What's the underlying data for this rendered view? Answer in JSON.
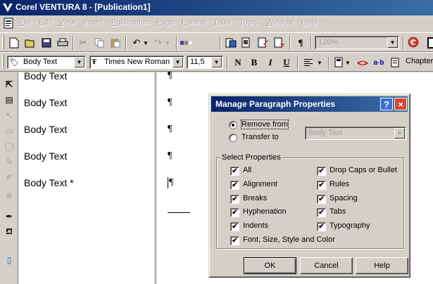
{
  "window": {
    "title": "Corel VENTURA 8 - [Publication1]",
    "app_icon": "ventura-logo-icon"
  },
  "menubar": {
    "items": [
      {
        "label": "File",
        "mnemonic": "F",
        "rest": "ile"
      },
      {
        "label": "Edit",
        "mnemonic": "E",
        "rest": "dit"
      },
      {
        "label": "View",
        "mnemonic": "V",
        "rest": "iew"
      },
      {
        "label": "Insert",
        "mnemonic": "I",
        "rest": "nsert"
      },
      {
        "label": "Publication",
        "mnemonic": "P",
        "rest": "ublication"
      },
      {
        "label": "Page",
        "mnemonic": "P",
        "rest": "age"
      },
      {
        "label": "Format",
        "mnemonic": "F",
        "rest": "ormat"
      },
      {
        "label": "Table",
        "mnemonic": "T",
        "rest": "able"
      },
      {
        "label": "Tools",
        "mnemonic": "T",
        "rest": "ools"
      },
      {
        "label": "Window",
        "mnemonic": "W",
        "rest": "indow"
      },
      {
        "label": "Help",
        "mnemonic": "H",
        "rest": "elp"
      }
    ]
  },
  "toolbar_standard": {
    "zoom_value": "120%",
    "icons": [
      "new-icon",
      "open-icon",
      "save-icon",
      "print-icon",
      "cut-icon",
      "copy-icon",
      "paste-icon",
      "undo-icon",
      "redo-icon",
      "color-swatch-icon",
      "import-icon",
      "export-icon",
      "pilcrow-icon",
      "zoom-icon"
    ]
  },
  "toolbar_format": {
    "tag_value": "Body Text",
    "font_value": "Times New Roman",
    "size_value": "11,5",
    "bold": "B",
    "italic": "I",
    "underline": "U",
    "normal": "N",
    "chapter_label": "Chapter"
  },
  "tag_list": {
    "items": [
      "Body Text",
      "Body Text",
      "Body Text",
      "Body Text",
      "Body Text *"
    ]
  },
  "document": {
    "pilcrow": "¶"
  },
  "dialog": {
    "title": "Manage Paragraph Properties",
    "help_glyph": "?",
    "close_glyph": "×",
    "remove_from_label": "Remove from",
    "transfer_to_label": "Transfer to",
    "transfer_to_value": "Body Text",
    "group_label": "Select Properties",
    "properties_left": [
      "All",
      "Alignment",
      "Breaks",
      "Hyphenation",
      "Indents",
      "Font, Size, Style and Color"
    ],
    "properties_right": [
      "Drop Caps or Bullet",
      "Rules",
      "Spacing",
      "Tabs",
      "Typography"
    ],
    "check_glyph": "✔",
    "ok_label": "OK",
    "cancel_label": "Cancel",
    "help_label": "Help"
  }
}
